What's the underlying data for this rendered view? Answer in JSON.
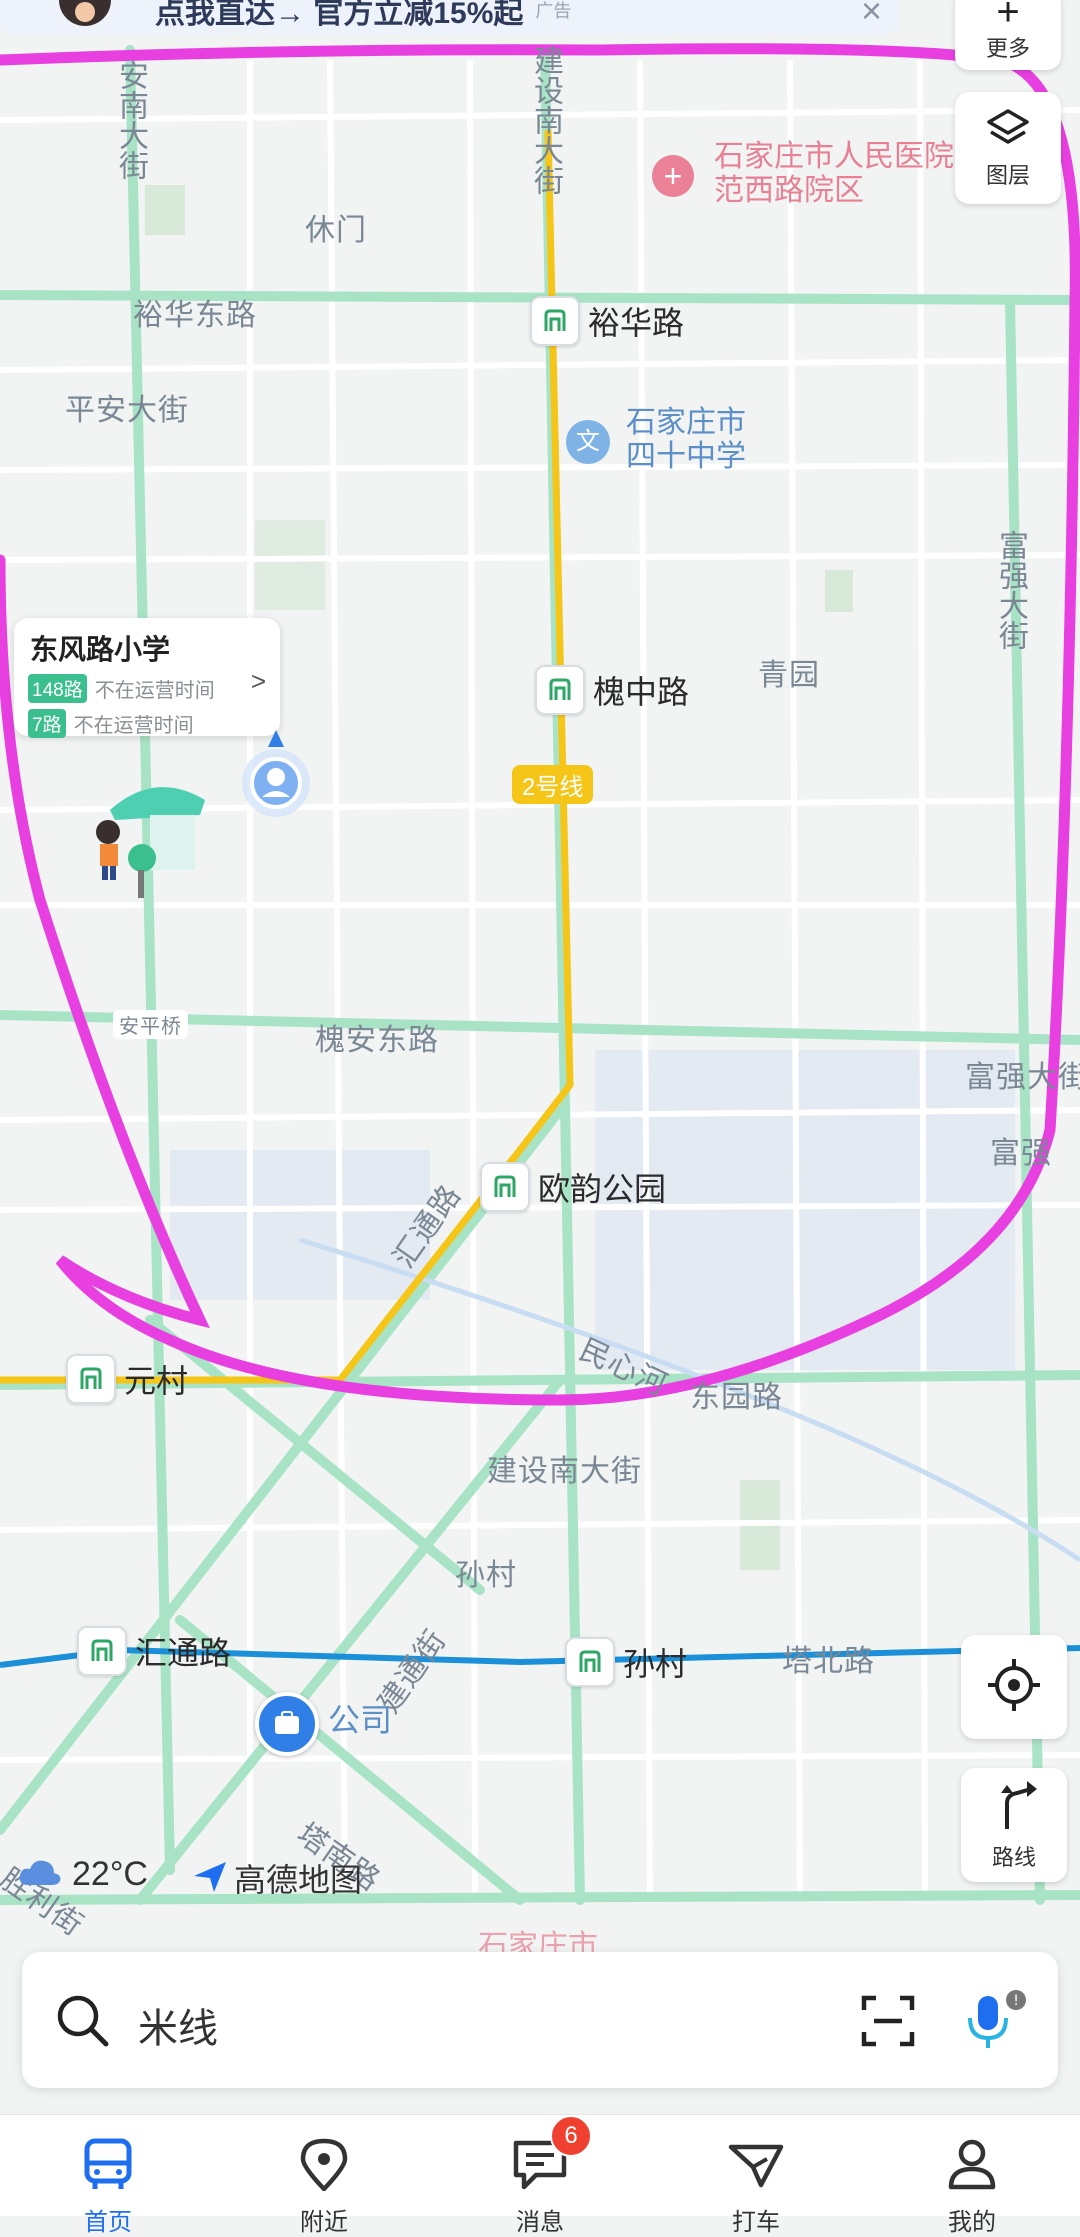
{
  "banner": {
    "text": "点我直达→ 官方立减15%起",
    "ad_label": "广告",
    "close": "×"
  },
  "map_controls": {
    "more_label": "更多",
    "layers_label": "图层",
    "route_label": "路线"
  },
  "map_labels": {
    "streets": [
      "裕华东路",
      "平安大街",
      "休门",
      "青园",
      "槐安东路",
      "建设南大街",
      "孙村",
      "安平桥",
      "富强大街",
      "富强",
      "富强大街"
    ],
    "v_jianshe": "建设南大街",
    "v_anan": "安南大街",
    "v_fuqiang": "富强大街",
    "huitong_diag": "汇通路",
    "jianshe_diag": "建通街",
    "minxin": "民心河",
    "yuanrun": "东园路",
    "tabei": "塔北路",
    "tanan": "塔南路",
    "shengli": "胜利街",
    "line2": "2号线"
  },
  "pois": {
    "hospital": "石家庄市人民医院范西路院区",
    "school": "石家庄市四十中学",
    "bottom_poi": "石家庄市",
    "company": "公司"
  },
  "stations": {
    "yuhua": "裕华路",
    "huaizhong": "槐中路",
    "ouyun": "欧韵公园",
    "yuancun": "元村",
    "huitong": "汇通路",
    "suncun": "孙村"
  },
  "bus_stop_card": {
    "name": "东风路小学",
    "routes": [
      {
        "badge": "148路",
        "status": "不在运营时间"
      },
      {
        "badge": "7路",
        "status": "不在运营时间"
      }
    ],
    "chevron": ">"
  },
  "weather": {
    "temp": "22°C"
  },
  "brand": {
    "name": "高德地图"
  },
  "search": {
    "placeholder": "米线"
  },
  "tabbar": {
    "items": [
      {
        "label": "首页",
        "active": true
      },
      {
        "label": "附近"
      },
      {
        "label": "消息",
        "badge": "6"
      },
      {
        "label": "打车"
      },
      {
        "label": "我的"
      }
    ]
  },
  "colors": {
    "accent": "#1e6ff0",
    "metro_line2": "#f5c518",
    "metro_line_blue": "#1b8fd8",
    "annotation": "#e83fe0",
    "road": "#9fe0bf"
  }
}
